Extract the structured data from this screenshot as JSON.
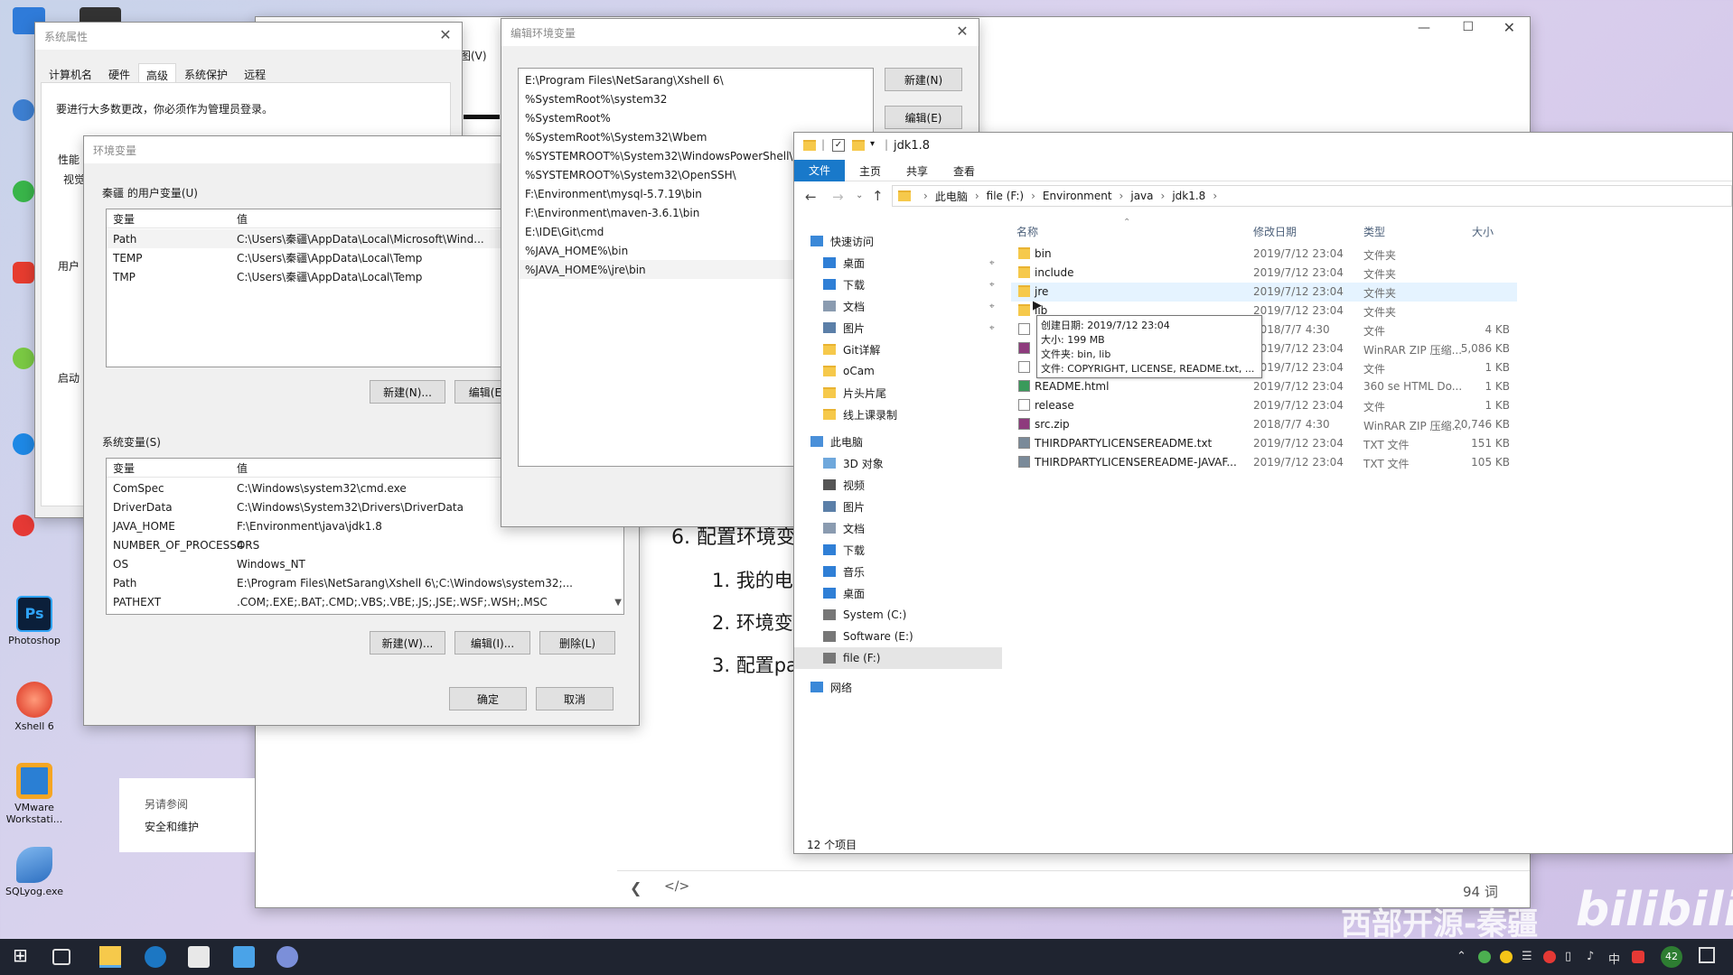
{
  "desktop": {
    "icons": [
      {
        "label": "Photoshop"
      },
      {
        "label": "Xshell 6"
      },
      {
        "label": "VMware Workstati..."
      },
      {
        "label": "SQLyog.exe"
      }
    ]
  },
  "sysprops": {
    "title": "系统属性",
    "tabs": [
      "计算机名",
      "硬件",
      "高级",
      "系统保护",
      "远程"
    ],
    "admin_note": "要进行大多数更改，你必须作为管理员登录。",
    "perf_label": "性能",
    "visual_label": "视觉",
    "user_label": "用户",
    "start_label": "启动",
    "also_see": "另请参阅",
    "security_link": "安全和维护"
  },
  "envvars": {
    "title": "环境变量",
    "user_section": "秦疆 的用户变量(U)",
    "col_var": "变量",
    "col_val": "值",
    "user_vars": [
      {
        "name": "Path",
        "value": "C:\\Users\\秦疆\\AppData\\Local\\Microsoft\\Wind..."
      },
      {
        "name": "TEMP",
        "value": "C:\\Users\\秦疆\\AppData\\Local\\Temp"
      },
      {
        "name": "TMP",
        "value": "C:\\Users\\秦疆\\AppData\\Local\\Temp"
      }
    ],
    "user_new": "新建(N)...",
    "user_edit": "编辑(E)...",
    "sys_section": "系统变量(S)",
    "sys_vars": [
      {
        "name": "ComSpec",
        "value": "C:\\Windows\\system32\\cmd.exe"
      },
      {
        "name": "DriverData",
        "value": "C:\\Windows\\System32\\Drivers\\DriverData"
      },
      {
        "name": "JAVA_HOME",
        "value": "F:\\Environment\\java\\jdk1.8"
      },
      {
        "name": "NUMBER_OF_PROCESSORS",
        "value": "4"
      },
      {
        "name": "OS",
        "value": "Windows_NT"
      },
      {
        "name": "Path",
        "value": "E:\\Program Files\\NetSarang\\Xshell 6\\;C:\\Windows\\system32;..."
      },
      {
        "name": "PATHEXT",
        "value": ".COM;.EXE;.BAT;.CMD;.VBS;.VBE;.JS;.JSE;.WSF;.WSH;.MSC"
      }
    ],
    "sys_new": "新建(W)...",
    "sys_edit": "编辑(I)...",
    "sys_delete": "删除(L)",
    "ok": "确定",
    "cancel": "取消"
  },
  "editenv": {
    "title": "编辑环境变量",
    "entries": [
      "E:\\Program Files\\NetSarang\\Xshell 6\\",
      "%SystemRoot%\\system32",
      "%SystemRoot%",
      "%SystemRoot%\\System32\\Wbem",
      "%SYSTEMROOT%\\System32\\WindowsPowerShell\\v1.0\\",
      "%SYSTEMROOT%\\System32\\OpenSSH\\",
      "F:\\Environment\\mysql-5.7.19\\bin",
      "F:\\Environment\\maven-3.6.1\\bin",
      "E:\\IDE\\Git\\cmd",
      "%JAVA_HOME%\\bin",
      "%JAVA_HOME%\\jre\\bin"
    ],
    "new_btn": "新建(N)",
    "edit_btn": "编辑(E)"
  },
  "doc": {
    "menu_fragment": "图(V)",
    "heading": "6. 配置环境变",
    "items": [
      "1. 我的电",
      "2. 环境变",
      "3. 配置pa"
    ],
    "word_count": "94 词"
  },
  "explorer": {
    "title": "jdk1.8",
    "ribbon_tabs": [
      "文件",
      "主页",
      "共享",
      "查看"
    ],
    "breadcrumb": [
      "此电脑",
      "file (F:)",
      "Environment",
      "java",
      "jdk1.8"
    ],
    "columns": {
      "name": "名称",
      "date": "修改日期",
      "type": "类型",
      "size": "大小"
    },
    "nav": [
      {
        "label": "快速访问",
        "kind": "star"
      },
      {
        "label": "桌面",
        "kind": "desktop",
        "pinned": true
      },
      {
        "label": "下载",
        "kind": "download",
        "pinned": true
      },
      {
        "label": "文档",
        "kind": "doc",
        "pinned": true
      },
      {
        "label": "图片",
        "kind": "pic",
        "pinned": true
      },
      {
        "label": "Git详解",
        "kind": "folder"
      },
      {
        "label": "oCam",
        "kind": "folder"
      },
      {
        "label": "片头片尾",
        "kind": "folder"
      },
      {
        "label": "线上课录制",
        "kind": "folder"
      },
      {
        "label": "此电脑",
        "kind": "pc"
      },
      {
        "label": "3D 对象",
        "kind": "cube"
      },
      {
        "label": "视频",
        "kind": "video"
      },
      {
        "label": "图片",
        "kind": "pic"
      },
      {
        "label": "文档",
        "kind": "doc"
      },
      {
        "label": "下载",
        "kind": "download"
      },
      {
        "label": "音乐",
        "kind": "music"
      },
      {
        "label": "桌面",
        "kind": "desktop"
      },
      {
        "label": "System (C:)",
        "kind": "drive"
      },
      {
        "label": "Software (E:)",
        "kind": "drive"
      },
      {
        "label": "file (F:)",
        "kind": "drive",
        "selected": true
      },
      {
        "label": "网络",
        "kind": "network"
      }
    ],
    "files": [
      {
        "name": "bin",
        "date": "2019/7/12 23:04",
        "type": "文件夹",
        "size": "",
        "kind": "folder"
      },
      {
        "name": "include",
        "date": "2019/7/12 23:04",
        "type": "文件夹",
        "size": "",
        "kind": "folder"
      },
      {
        "name": "jre",
        "date": "2019/7/12 23:04",
        "type": "文件夹",
        "size": "",
        "kind": "folder"
      },
      {
        "name": "lib",
        "date": "2019/7/12 23:04",
        "type": "文件夹",
        "size": "",
        "kind": "folder"
      },
      {
        "name": "",
        "date": "2018/7/7 4:30",
        "type": "文件",
        "size": "4 KB",
        "kind": "file"
      },
      {
        "name": "",
        "date": "2019/7/12 23:04",
        "type": "WinRAR ZIP 压缩...",
        "size": "5,086 KB",
        "kind": "zip"
      },
      {
        "name": "",
        "date": "2019/7/12 23:04",
        "type": "文件",
        "size": "1 KB",
        "kind": "file"
      },
      {
        "name": "README.html",
        "date": "2019/7/12 23:04",
        "type": "360 se HTML Do...",
        "size": "1 KB",
        "kind": "html"
      },
      {
        "name": "release",
        "date": "2019/7/12 23:04",
        "type": "文件",
        "size": "1 KB",
        "kind": "file"
      },
      {
        "name": "src.zip",
        "date": "2018/7/7 4:30",
        "type": "WinRAR ZIP 压缩...",
        "size": "20,746 KB",
        "kind": "zip"
      },
      {
        "name": "THIRDPARTYLICENSEREADME.txt",
        "date": "2019/7/12 23:04",
        "type": "TXT 文件",
        "size": "151 KB",
        "kind": "txt"
      },
      {
        "name": "THIRDPARTYLICENSEREADME-JAVAF...",
        "date": "2019/7/12 23:04",
        "type": "TXT 文件",
        "size": "105 KB",
        "kind": "txt"
      }
    ],
    "tooltip": [
      "创建日期: 2019/7/12 23:04",
      "大小: 199 MB",
      "文件夹: bin, lib",
      "文件: COPYRIGHT, LICENSE, README.txt, ..."
    ],
    "status": "12 个项目"
  },
  "watermark": {
    "author": "西部开源-秦疆",
    "logo": "bilibili"
  },
  "taskbar": {
    "tray_text": "中",
    "badge": "42"
  }
}
